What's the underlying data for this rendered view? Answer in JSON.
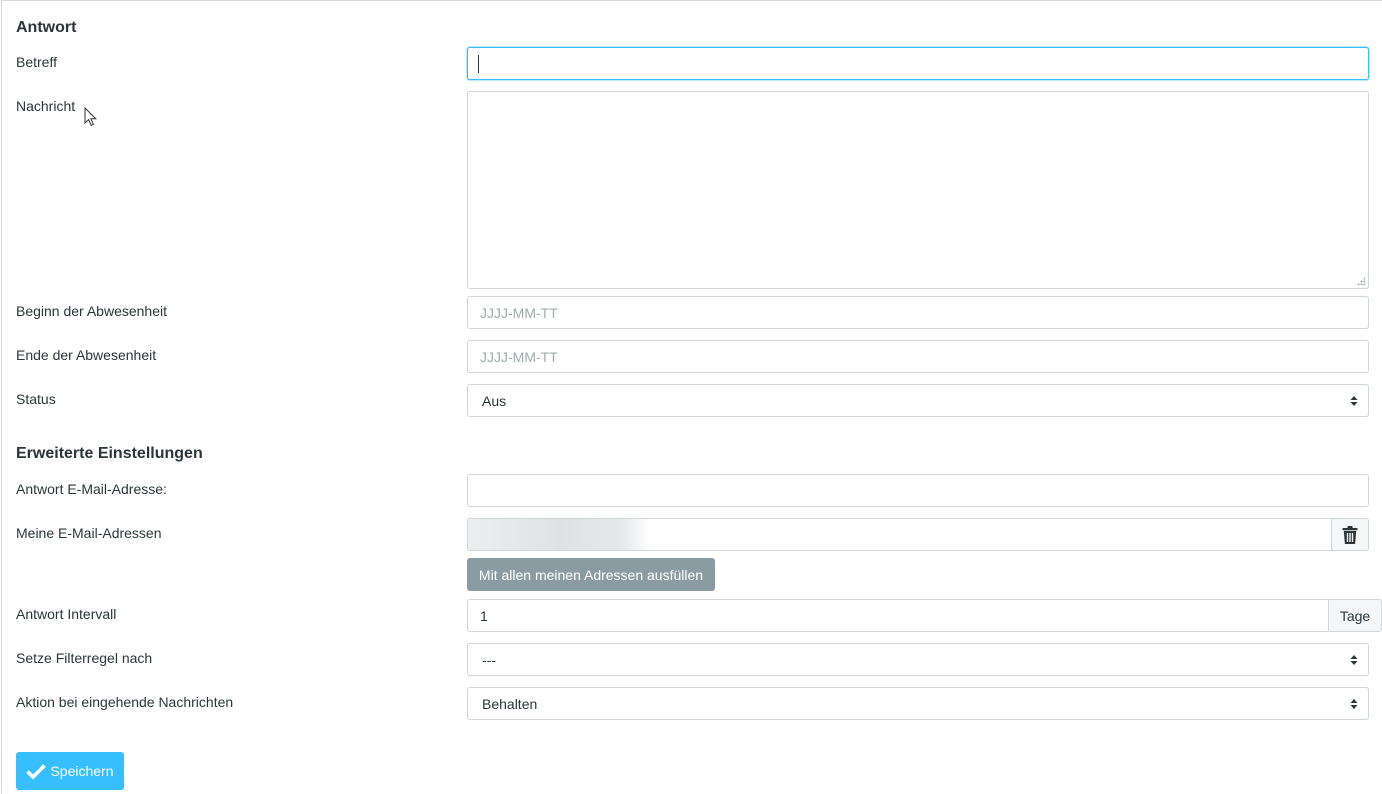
{
  "sections": {
    "reply_title": "Antwort",
    "advanced_title": "Erweiterte Einstellungen"
  },
  "labels": {
    "subject": "Betreff",
    "message": "Nachricht",
    "start": "Beginn der Abwesenheit",
    "end": "Ende der Abwesenheit",
    "status": "Status",
    "reply_email": "Antwort E-Mail-Adresse:",
    "my_emails": "Meine E-Mail-Adressen",
    "interval": "Antwort Intervall",
    "filter": "Setze Filterregel nach",
    "action": "Aktion bei eingehende Nachrichten"
  },
  "fields": {
    "subject_value": "",
    "message_value": "",
    "start_placeholder": "JJJJ-MM-TT",
    "end_placeholder": "JJJJ-MM-TT",
    "status_value": "Aus",
    "reply_email_value": "",
    "interval_value": "1",
    "interval_unit": "Tage",
    "filter_value": "---",
    "action_value": "Behalten"
  },
  "buttons": {
    "fill_all": "Mit allen meinen Adressen ausfüllen",
    "save": "Speichern"
  },
  "icons": {
    "delete": "trash-icon",
    "save": "checkmark-icon",
    "select": "sort-arrows-icon"
  },
  "colors": {
    "accent": "#37beff",
    "secondary_button": "#8a9ba2",
    "text": "#2c363a"
  }
}
